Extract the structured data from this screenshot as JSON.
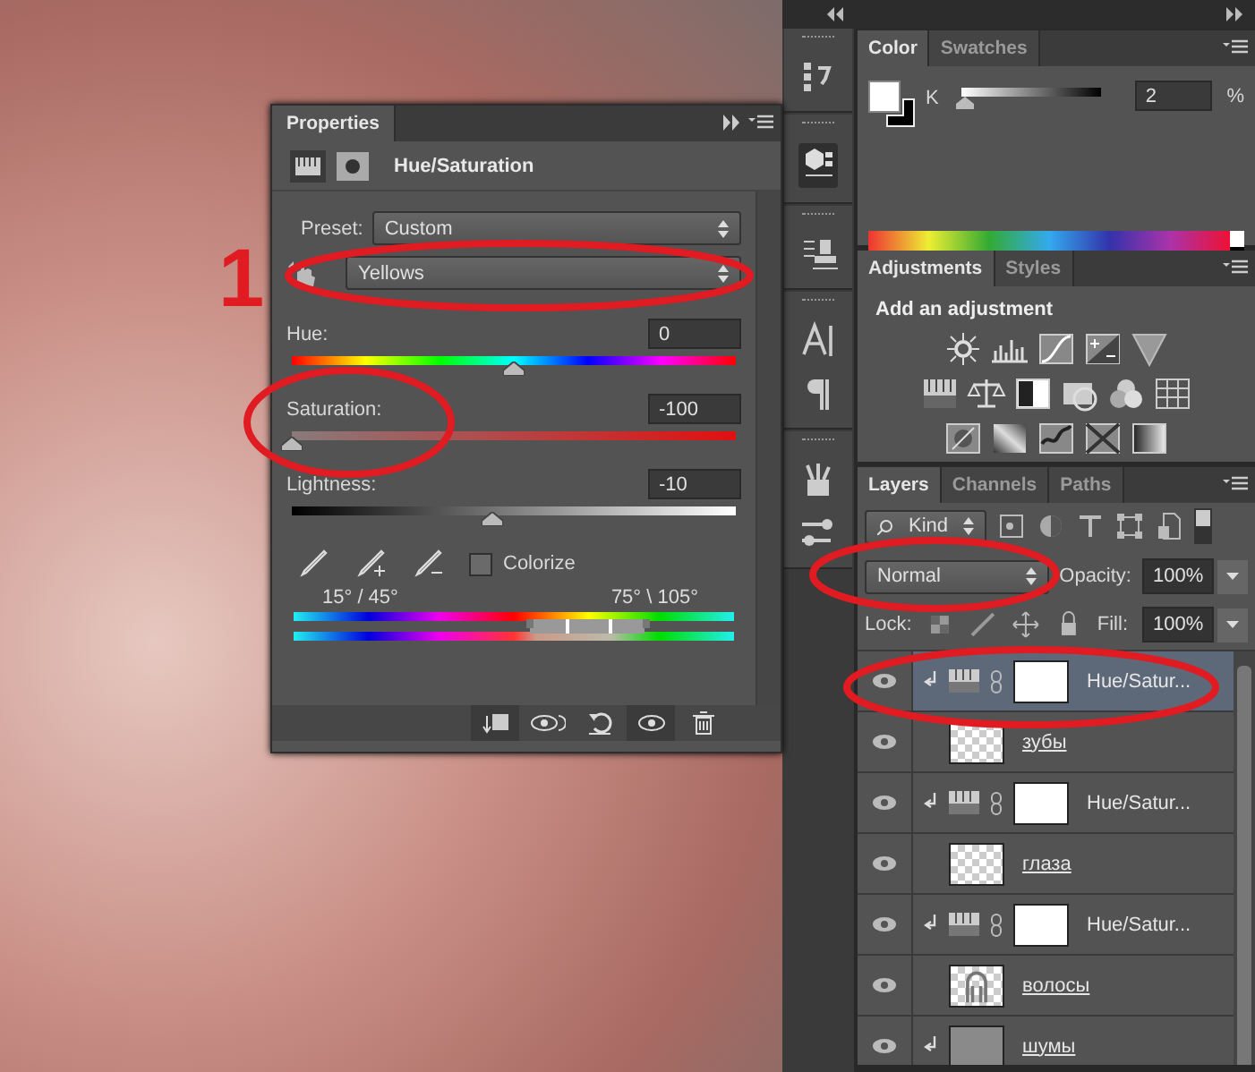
{
  "annotation": {
    "number": "1"
  },
  "properties": {
    "tab": "Properties",
    "title": "Hue/Saturation",
    "preset_label": "Preset:",
    "preset": "Custom",
    "range": "Yellows",
    "sliders": [
      {
        "kind": "hue",
        "label": "Hue:",
        "value": "0",
        "level": 0.5
      },
      {
        "kind": "saturation",
        "label": "Saturation:",
        "value": "-100",
        "level": 0.0
      },
      {
        "kind": "lightness",
        "label": "Lightness:",
        "value": "-10",
        "level": 0.45
      }
    ],
    "colorize": {
      "label": "Colorize",
      "checked": false
    },
    "range_left": "15° / 45°",
    "range_right": "75° \\ 105°"
  },
  "color_panel": {
    "tabs": [
      {
        "label": "Color",
        "selected": true
      },
      {
        "label": "Swatches",
        "selected": false
      }
    ],
    "channel": "K",
    "value": "2",
    "unit": "%",
    "level": 0.02
  },
  "adjustments_panel": {
    "tabs": [
      {
        "label": "Adjustments",
        "selected": true
      },
      {
        "label": "Styles",
        "selected": false
      }
    ],
    "heading": "Add an adjustment"
  },
  "layers_panel": {
    "tabs": [
      {
        "label": "Layers",
        "selected": true
      },
      {
        "label": "Channels",
        "selected": false
      },
      {
        "label": "Paths",
        "selected": false
      }
    ],
    "filter": "Kind",
    "blend_mode": "Normal",
    "opacity_label": "Opacity:",
    "opacity": "100%",
    "lock_label": "Lock:",
    "fill_label": "Fill:",
    "fill": "100%",
    "layers": [
      {
        "name": "Hue/Satur...",
        "kind": "adjustment",
        "clipped": true,
        "selected": true
      },
      {
        "name": "зубы",
        "kind": "transparent",
        "clipped": false,
        "selected": false
      },
      {
        "name": "Hue/Satur...",
        "kind": "adjustment",
        "clipped": true,
        "selected": false
      },
      {
        "name": "глаза",
        "kind": "transparent",
        "clipped": false,
        "selected": false
      },
      {
        "name": "Hue/Satur...",
        "kind": "adjustment",
        "clipped": true,
        "selected": false
      },
      {
        "name": "волосы",
        "kind": "hair",
        "clipped": false,
        "selected": false
      },
      {
        "name": "шумы",
        "kind": "gray",
        "clipped": true,
        "selected": false
      }
    ]
  }
}
